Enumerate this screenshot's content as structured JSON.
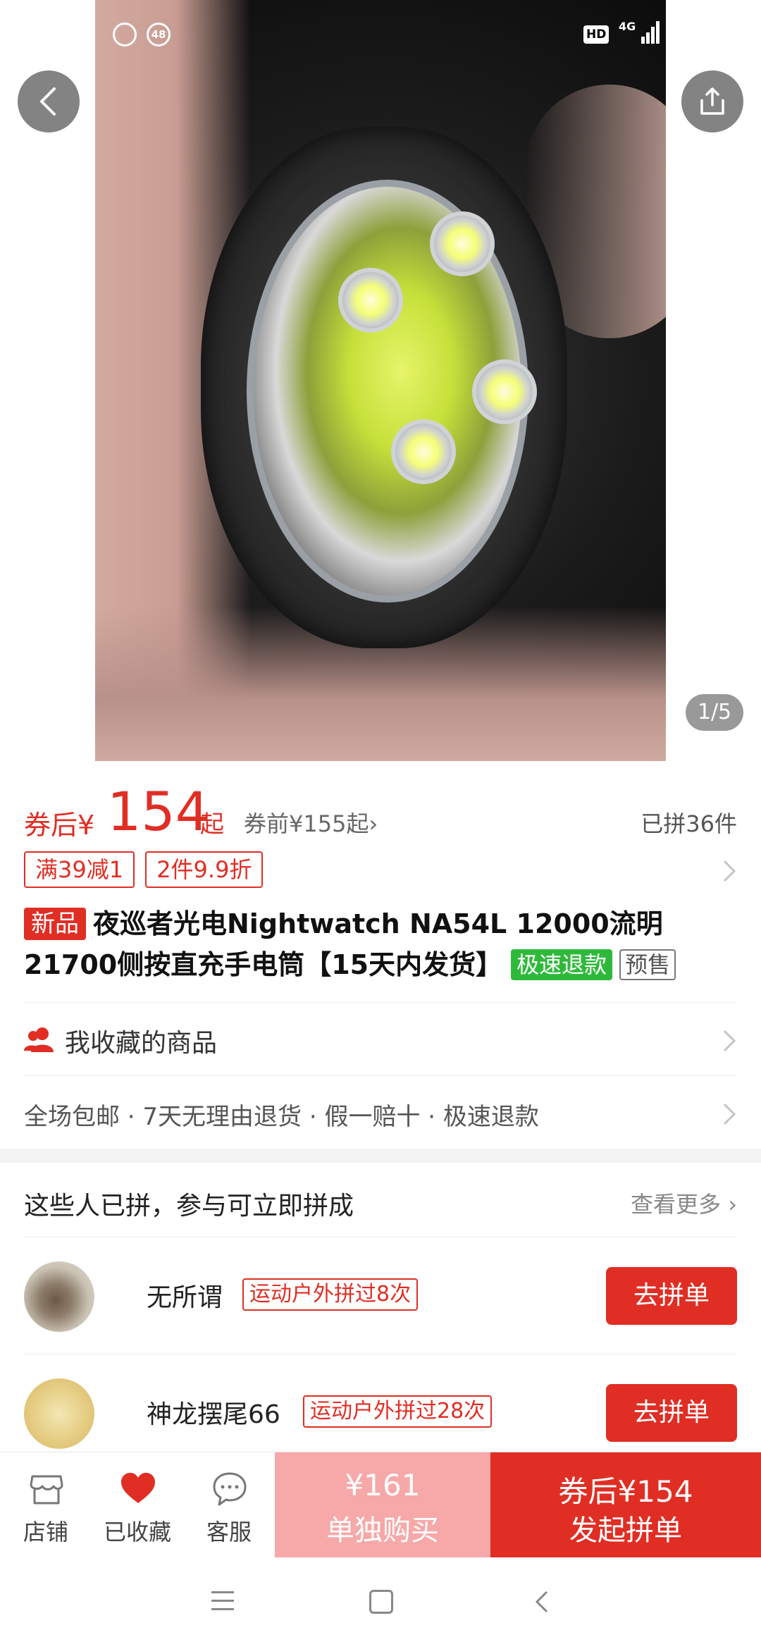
{
  "status_bar": {
    "notification_count": "48",
    "hd": "HD",
    "network": "4G"
  },
  "gallery": {
    "counter": "1/5"
  },
  "price": {
    "prefix": "券后¥",
    "amount": "154",
    "suffix": "起",
    "original": "券前¥155起",
    "original_chevron": "›",
    "sold": "已拼36件"
  },
  "promos": [
    "满39减1",
    "2件9.9折"
  ],
  "product": {
    "new_tag": "新品",
    "title": "夜巡者光电Nightwatch NA54L 12000流明 21700侧按直充手电筒【15天内发货】",
    "fast_refund_tag": "极速退款",
    "presale_tag": "预售"
  },
  "favorites_row": {
    "label": "我收藏的商品"
  },
  "services": {
    "text": "全场包邮 · 7天无理由退货 · 假一赔十 · 极速退款"
  },
  "group_section": {
    "title": "这些人已拼，参与可立即拼成",
    "more": "查看更多",
    "items": [
      {
        "name": "无所谓",
        "tag": "运动户外拼过8次",
        "button": "去拼单"
      },
      {
        "name": "神龙摆尾66",
        "tag": "运动户外拼过28次",
        "button": "去拼单"
      }
    ]
  },
  "bottom_bar": {
    "store": "店铺",
    "favorited": "已收藏",
    "service": "客服",
    "solo_price": "¥161",
    "solo_label": "单独购买",
    "group_price": "券后¥154",
    "group_label": "发起拼单"
  },
  "colors": {
    "accent": "#e02e24",
    "solo_bg": "#f7a8a8",
    "fast_refund": "#2fb93b"
  },
  "icons": [
    "back-icon",
    "share-icon",
    "store-icon",
    "heart-icon",
    "chat-icon",
    "users-icon",
    "chevron-right-icon"
  ]
}
